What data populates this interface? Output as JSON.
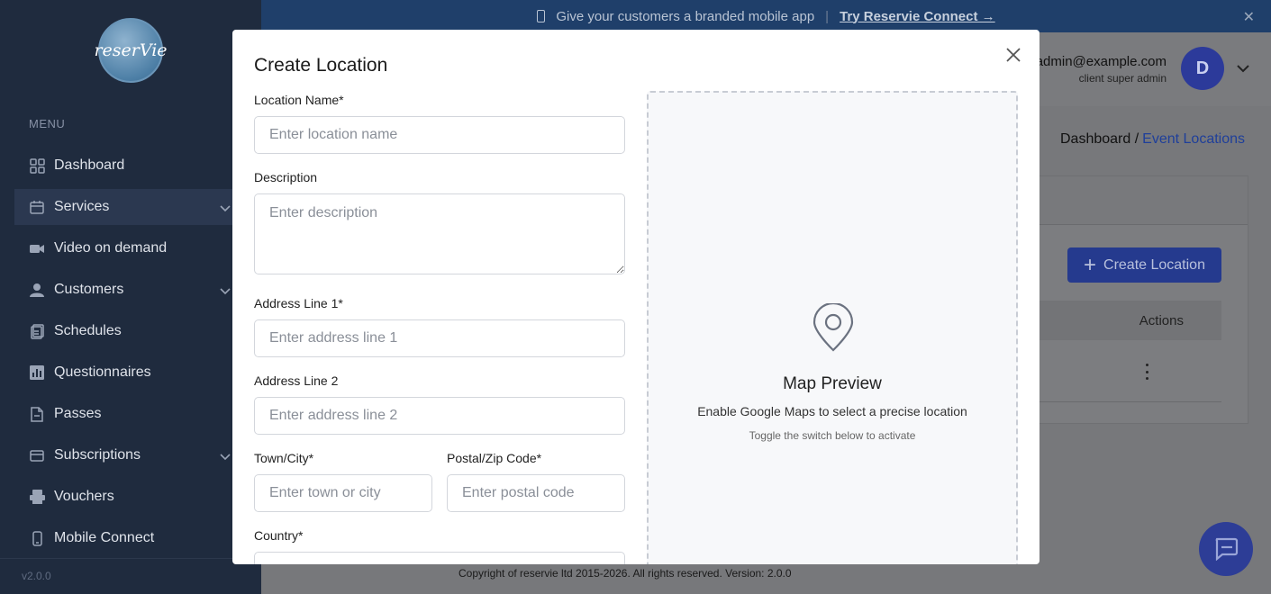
{
  "sidebar": {
    "logo_text": "reserVie",
    "menu_label": "MENU",
    "items": [
      {
        "label": "Dashboard",
        "icon": "grid-icon"
      },
      {
        "label": "Services",
        "icon": "calendar-icon",
        "expandable": true,
        "active": true
      },
      {
        "label": "Video on demand",
        "icon": "video-icon"
      },
      {
        "label": "Customers",
        "icon": "user-icon",
        "expandable": true
      },
      {
        "label": "Schedules",
        "icon": "schedule-icon"
      },
      {
        "label": "Questionnaires",
        "icon": "chart-icon"
      },
      {
        "label": "Passes",
        "icon": "document-icon"
      },
      {
        "label": "Subscriptions",
        "icon": "card-icon",
        "expandable": true
      },
      {
        "label": "Vouchers",
        "icon": "voucher-icon"
      },
      {
        "label": "Mobile Connect",
        "icon": "phone-icon"
      }
    ],
    "version": "v2.0.0"
  },
  "banner": {
    "text": "Give your customers a branded mobile app",
    "separator": "|",
    "link_text": "Try Reservie Connect →",
    "close": "✕"
  },
  "header": {
    "email": "admin@example.com",
    "role": "client super admin",
    "avatar_initial": "D"
  },
  "breadcrumb": {
    "parent": "Dashboard /",
    "current": "Event Locations"
  },
  "page": {
    "create_button": "Create Location",
    "actions_header": "Actions",
    "copyright": "Copyright of reservie ltd 2015-2026. All rights reserved. Version: 2.0.0"
  },
  "modal": {
    "title": "Create Location",
    "fields": {
      "location_name": {
        "label": "Location Name*",
        "placeholder": "Enter location name"
      },
      "description": {
        "label": "Description",
        "placeholder": "Enter description"
      },
      "address1": {
        "label": "Address Line 1*",
        "placeholder": "Enter address line 1"
      },
      "address2": {
        "label": "Address Line 2",
        "placeholder": "Enter address line 2"
      },
      "town": {
        "label": "Town/City*",
        "placeholder": "Enter town or city"
      },
      "postal": {
        "label": "Postal/Zip Code*",
        "placeholder": "Enter postal code"
      },
      "country": {
        "label": "Country*"
      }
    },
    "map": {
      "title": "Map Preview",
      "subtitle": "Enable Google Maps to select a precise location",
      "hint": "Toggle the switch below to activate"
    }
  },
  "colors": {
    "sidebar_bg": "#1f2b3e",
    "accent": "#3f5bd6",
    "banner_bg": "#1f3f6a"
  }
}
